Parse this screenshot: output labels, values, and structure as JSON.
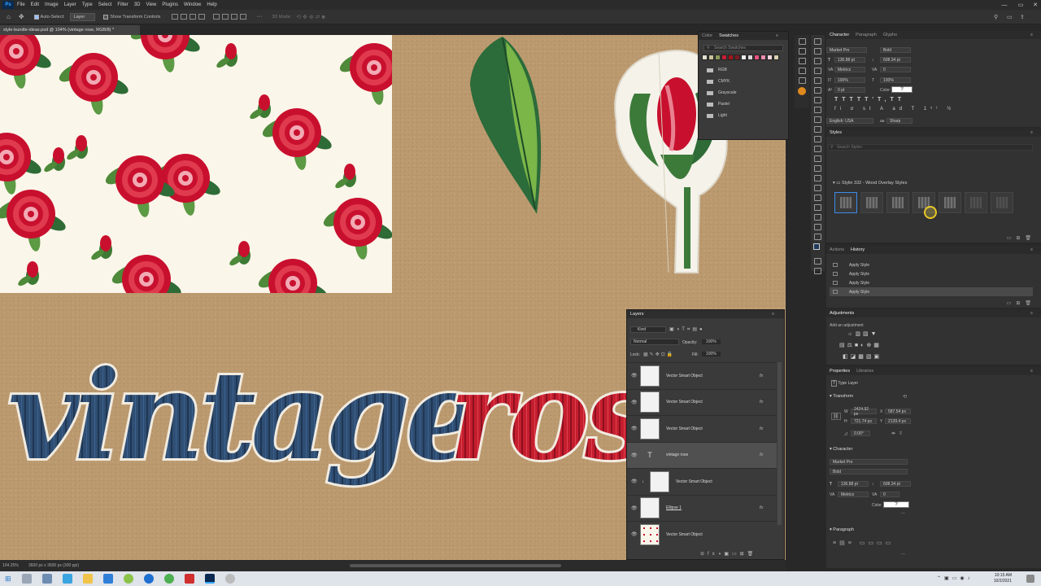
{
  "app": {
    "menu": [
      "File",
      "Edit",
      "Image",
      "Layer",
      "Type",
      "Select",
      "Filter",
      "3D",
      "View",
      "Plugins",
      "Window",
      "Help"
    ],
    "ps_logo": "Ps"
  },
  "options_bar": {
    "auto_select_label": "Auto-Select:",
    "auto_select_target": "Layer",
    "show_transform_label": "Show Transform Controls",
    "mode_3d_label": "3D Mode:"
  },
  "document": {
    "tab_title": "style-bundle-ideas.psd @ 104% (vintage rose, RGB/8) *",
    "canvas_text_1": "vintage",
    "canvas_text_2": "rose",
    "zoom": "104.25%",
    "doc_size": "3600 px x 3600 px (300 ppi)"
  },
  "swatches_panel": {
    "tabs": [
      "Color",
      "Swatches"
    ],
    "active_tab": "Swatches",
    "search_placeholder": "Search Swatches",
    "folders": [
      "RGB",
      "CMYK",
      "Grayscale",
      "Pastel",
      "Light"
    ],
    "recent_colors": [
      "#e0e0d0",
      "#c9c29a",
      "#8a9a5b",
      "#c71f37",
      "#a4161a",
      "#7a1c24",
      "#eeeeee",
      "#d8d8d8",
      "#e75480",
      "#f08db0",
      "#f5d6dc",
      "#d9d0b0"
    ]
  },
  "character_panel": {
    "tabs": [
      "Character",
      "Paragraph",
      "Glyphs"
    ],
    "font_family": "Market Pro",
    "font_style": "Bold",
    "font_size": "136.88 pt",
    "leading": "608.34 pt",
    "kerning": "Metrics",
    "tracking": "0",
    "vertical_scale": "100%",
    "horizontal_scale": "100%",
    "baseline_shift": "0 pt",
    "color_label": "Color:",
    "language": "English: USA",
    "antialias": "Sharp"
  },
  "styles_panel": {
    "title": "Styles",
    "search_placeholder": "Search Styles",
    "group_name": "Stylin 332 - Wood Overlay Styles",
    "thumb_count": 7
  },
  "history_panel": {
    "tabs": [
      "Actions",
      "History"
    ],
    "active_tab": "History",
    "items": [
      "Apply Style",
      "Apply Style",
      "Apply Style",
      "Apply Style"
    ]
  },
  "adjustments_panel": {
    "title": "Adjustments",
    "subtitle": "Add an adjustment"
  },
  "properties_panel": {
    "tabs": [
      "Properties",
      "Libraries"
    ],
    "layer_type": "Type Layer",
    "transform_label": "Transform",
    "w": "2424.92 px",
    "x": "587.54 px",
    "h": "721.74 px",
    "y": "2139.4 px",
    "angle": "0.00°",
    "character_label": "Character",
    "font_family": "Market Pro",
    "font_style": "Bold",
    "font_size": "136.88 pt",
    "leading": "608.34 pt",
    "kerning": "Metrics",
    "tracking": "0",
    "color_label": "Color",
    "paragraph_label": "Paragraph",
    "more": "..."
  },
  "layers_panel": {
    "title": "Layers",
    "filter_kind": "Kind",
    "blend_mode": "Normal",
    "opacity_label": "Opacity:",
    "opacity_value": "100%",
    "lock_label": "Lock:",
    "fill_label": "Fill:",
    "fill_value": "100%",
    "layers": [
      {
        "name": "Vector Smart Object",
        "fx": "fx",
        "type": "smart",
        "selected": false
      },
      {
        "name": "Vector Smart Object",
        "fx": "fx",
        "type": "smart",
        "selected": false
      },
      {
        "name": "Vector Smart Object",
        "fx": "fx",
        "type": "smart",
        "selected": false
      },
      {
        "name": "vintage rose",
        "fx": "fx",
        "type": "text",
        "selected": true
      },
      {
        "name": "Vector Smart Object",
        "fx": "",
        "type": "smart-clipped",
        "selected": false
      },
      {
        "name": "Ellipse 1",
        "fx": "fx",
        "type": "smart",
        "selected": false
      },
      {
        "name": "Vector Smart Object",
        "fx": "",
        "type": "pattern",
        "selected": false
      }
    ]
  },
  "taskbar": {
    "time": "10:15 AM",
    "date": "10/2/2021"
  },
  "colors": {
    "accent": "#31a8ff",
    "wood_blue": "#2c4a6e",
    "wood_red": "#c41e2e",
    "kraft": "#bc9a6f",
    "panel_bg": "#323232"
  }
}
